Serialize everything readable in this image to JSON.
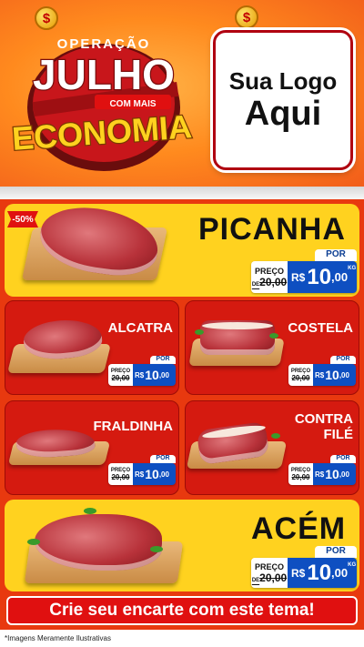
{
  "header": {
    "badge": {
      "line1": "OPERAÇÃO",
      "line2": "JULHO",
      "line3": "COM MAIS",
      "line4": "ECONOMIA",
      "coin_symbol": "$"
    },
    "logo_placeholder": {
      "line1": "Sua Logo",
      "line2": "Aqui"
    }
  },
  "products": [
    {
      "name": "PICANHA",
      "discount": "-50%",
      "por_label": "POR",
      "preco_label": "PREÇO",
      "de_label": "DE",
      "old_price": "20,00",
      "currency": "R$",
      "price_int": "10",
      "price_dec": ",00",
      "unit": "KG"
    },
    {
      "name": "ALCATRA",
      "por_label": "POR",
      "preco_label": "PREÇO",
      "de_label": "DE",
      "old_price": "20,00",
      "currency": "R$",
      "price_int": "10",
      "price_dec": ",00",
      "unit": "KG"
    },
    {
      "name": "COSTELA",
      "por_label": "POR",
      "preco_label": "PREÇO",
      "de_label": "DE",
      "old_price": "20,00",
      "currency": "R$",
      "price_int": "10",
      "price_dec": ",00",
      "unit": "KG"
    },
    {
      "name": "FRALDINHA",
      "por_label": "POR",
      "preco_label": "PREÇO",
      "de_label": "DE",
      "old_price": "20,00",
      "currency": "R$",
      "price_int": "10",
      "price_dec": ",00",
      "unit": "KG"
    },
    {
      "name_line1": "CONTRA",
      "name_line2": "FILÉ",
      "por_label": "POR",
      "preco_label": "PREÇO",
      "de_label": "DE",
      "old_price": "20,00",
      "currency": "R$",
      "price_int": "10",
      "price_dec": ",00",
      "unit": "KG"
    },
    {
      "name": "ACÉM",
      "por_label": "POR",
      "preco_label": "PREÇO",
      "de_label": "DE",
      "old_price": "20,00",
      "currency": "R$",
      "price_int": "10",
      "price_dec": ",00",
      "unit": "KG"
    }
  ],
  "cta": "Crie seu encarte com este tema!",
  "disclaimer": "*Imagens Meramente Ilustrativas",
  "colors": {
    "accent_red": "#e01010",
    "price_blue": "#0e4fc1",
    "yellow": "#ffd21f",
    "orange": "#f15a1a"
  }
}
